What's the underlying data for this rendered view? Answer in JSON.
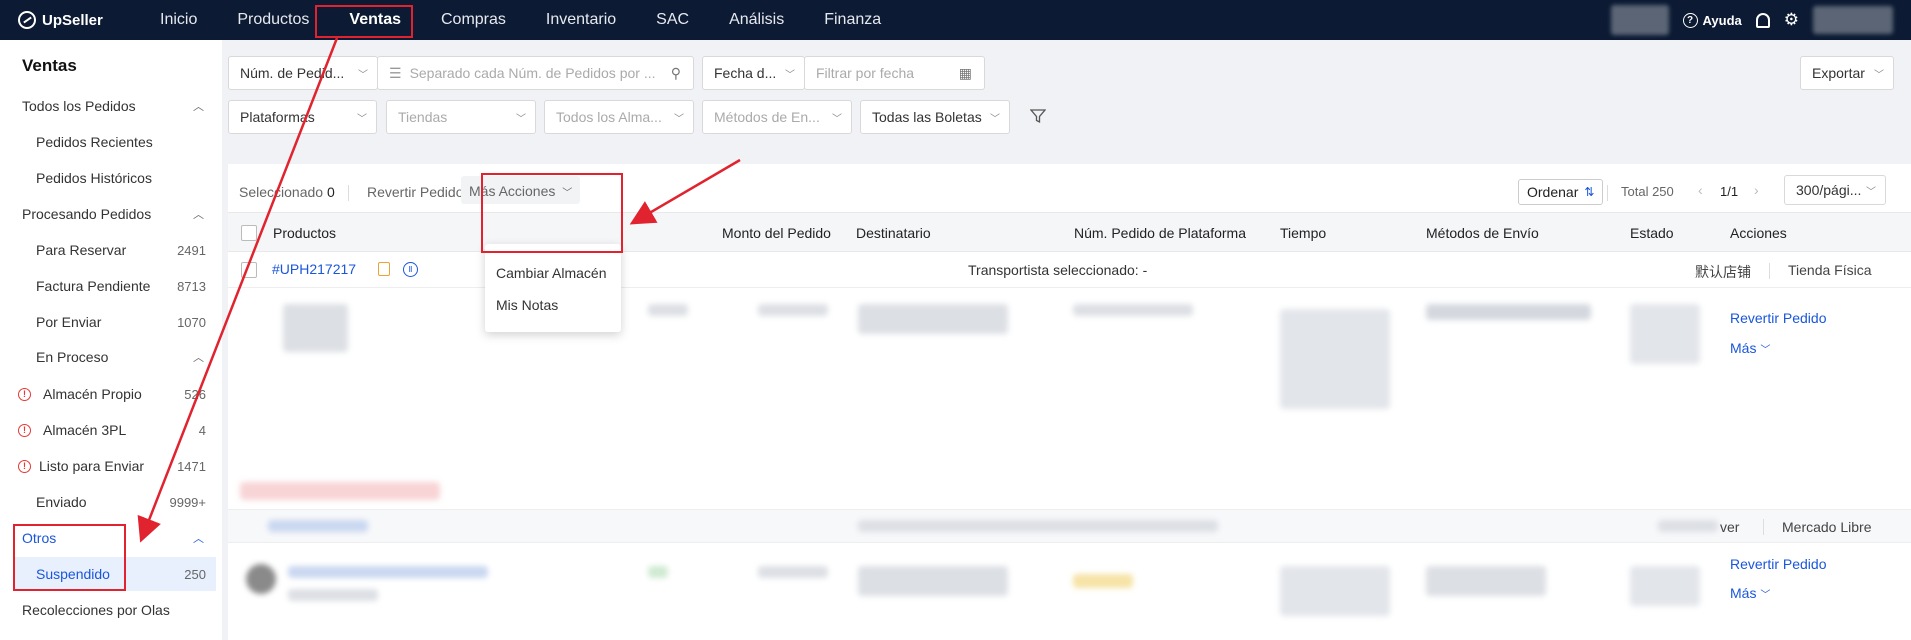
{
  "app": {
    "brand": "UpSeller"
  },
  "nav": {
    "items": [
      "Inicio",
      "Productos",
      "Ventas",
      "Compras",
      "Inventario",
      "SAC",
      "Análisis",
      "Finanza"
    ],
    "help": "Ayuda"
  },
  "sidebar": {
    "title": "Ventas",
    "all_orders": "Todos los Pedidos",
    "recent": "Pedidos Recientes",
    "historic": "Pedidos Históricos",
    "processing": "Procesando Pedidos",
    "to_reserve": {
      "label": "Para Reservar",
      "count": "2491"
    },
    "invoice_pending": {
      "label": "Factura Pendiente",
      "count": "8713"
    },
    "to_ship": {
      "label": "Por Enviar",
      "count": "1070"
    },
    "in_process": "En Proceso",
    "own_wh": {
      "label": "Almacén Propio",
      "count": "526"
    },
    "wh_3pl": {
      "label": "Almacén 3PL",
      "count": "4"
    },
    "ready": {
      "label": "Listo para Enviar",
      "count": "1471"
    },
    "sent": {
      "label": "Enviado",
      "count": "9999+"
    },
    "others": "Otros",
    "suspended": {
      "label": "Suspendido",
      "count": "250"
    },
    "waves": "Recolecciones por Olas"
  },
  "filters": {
    "order_num": "Núm. de Pedid...",
    "order_num_placeholder": "Separado cada Núm. de Pedidos por ...",
    "date_type": "Fecha d...",
    "date_placeholder": "Filtrar por fecha",
    "export": "Exportar",
    "platforms": "Plataformas",
    "stores": "Tiendas",
    "warehouses": "Todos los Alma...",
    "shipping": "Métodos de En...",
    "receipts": "Todas las Boletas"
  },
  "toolbar": {
    "selected_label": "Seleccionado",
    "selected_count": "0",
    "revert": "Revertir Pedido",
    "more_actions": "Más Acciones",
    "order": "Ordenar",
    "total": "Total 250",
    "page": "1/1",
    "per_page": "300/pági..."
  },
  "menu": {
    "items": [
      "Cambiar Almacén",
      "Mis Notas"
    ]
  },
  "table": {
    "columns": [
      "Productos",
      "Monto del Pedido",
      "Destinatario",
      "Núm. Pedido de Plataforma",
      "Tiempo",
      "Métodos de Envío",
      "Estado",
      "Acciones"
    ],
    "row1": {
      "id": "#UPH217217",
      "carrier": "Transportista seleccionado: -",
      "warehouse": "默认店铺",
      "store": "Tienda Física",
      "action_revert": "Revertir Pedido",
      "action_more": "Más"
    },
    "row2": {
      "store_partial": "ver",
      "store": "Mercado Libre",
      "action_revert": "Revertir Pedido",
      "action_more": "Más"
    }
  },
  "colors": {
    "nav_bg": "#0c1a33",
    "link": "#1a56db",
    "annotation_red": "#e0232e"
  }
}
